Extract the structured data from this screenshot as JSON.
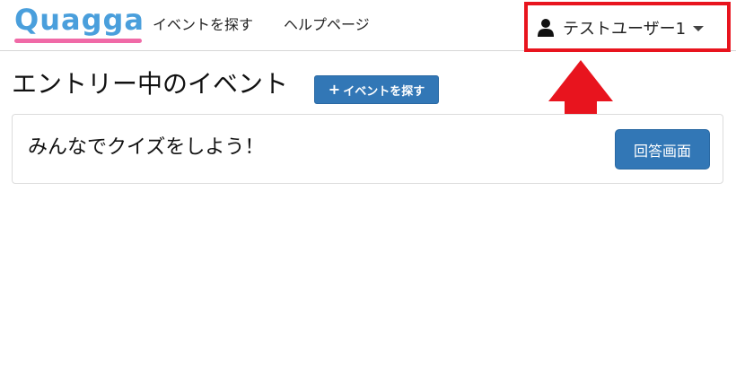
{
  "header": {
    "logo_text": "Quagga",
    "nav": [
      {
        "label": "イベントを探す"
      },
      {
        "label": "ヘルプページ"
      }
    ],
    "user": {
      "name": "テストユーザー1",
      "icon": "user-icon"
    }
  },
  "main": {
    "title": "エントリー中のイベント",
    "find_button": {
      "icon": "plus",
      "label": "イベントを探す"
    },
    "events": [
      {
        "name": "みんなでクイズをしよう！",
        "action_label": "回答画面"
      }
    ]
  },
  "annotations": {
    "highlight_color": "#e8141e"
  },
  "colors": {
    "primary": "#3277b6",
    "logo_blue": "#4a9fdc",
    "logo_pink": "#f06aa7"
  }
}
